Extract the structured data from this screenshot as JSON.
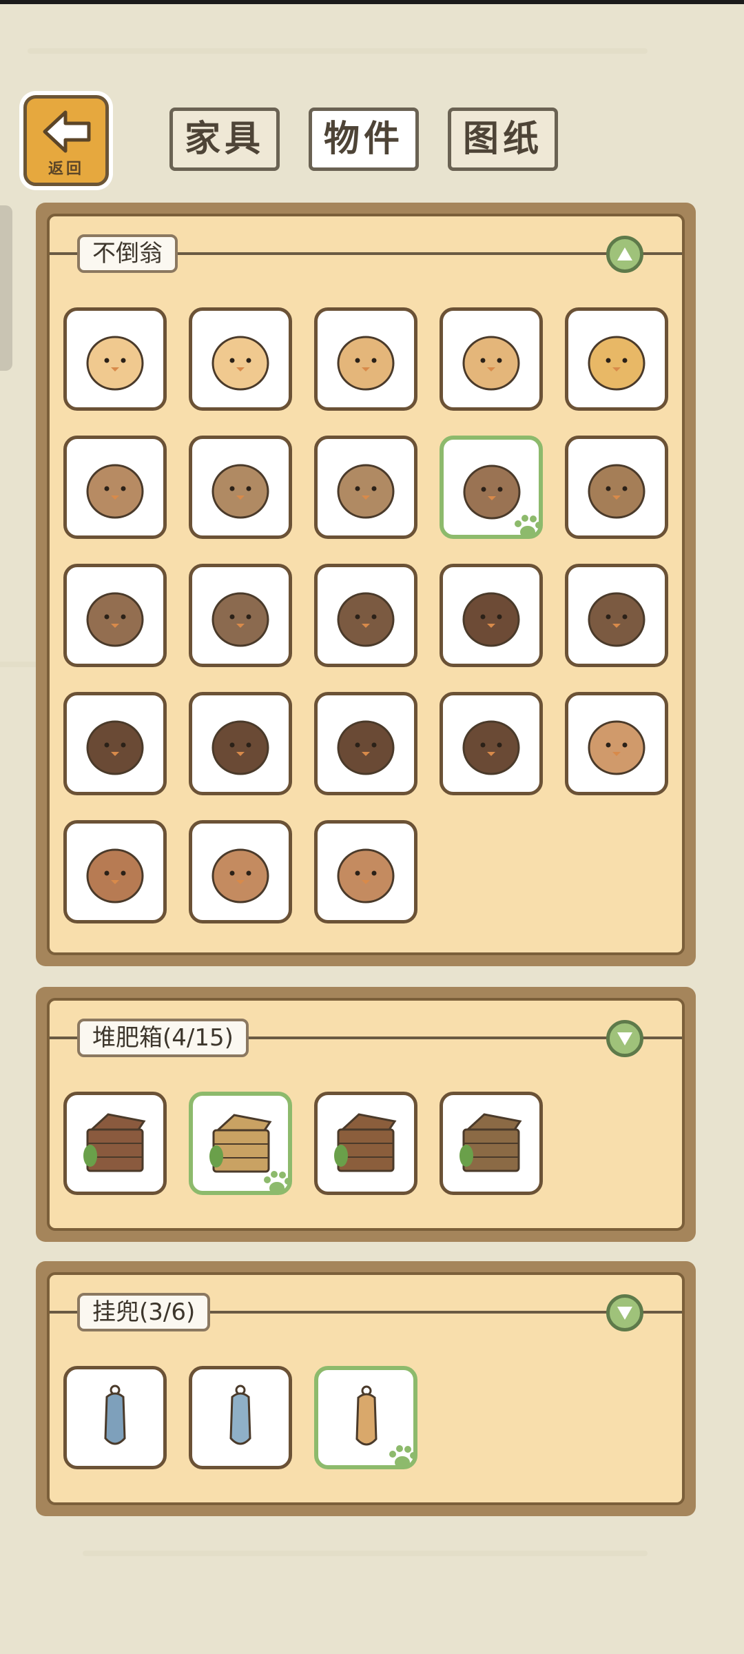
{
  "nav": {
    "back_label": "返回"
  },
  "tabs": [
    {
      "label": "家具",
      "active": false
    },
    {
      "label": "物件",
      "active": true
    },
    {
      "label": "图纸",
      "active": false
    }
  ],
  "sections": [
    {
      "title": "不倒翁",
      "toggle": "collapse-up-icon",
      "items": [
        {
          "icon": "tumbler-antenna-icon",
          "color": "#f0c98f",
          "selected": false
        },
        {
          "icon": "tumbler-cherry-icon",
          "color": "#f0c98f",
          "selected": false
        },
        {
          "icon": "tumbler-spotted-icon",
          "color": "#e4b67a",
          "selected": false
        },
        {
          "icon": "tumbler-heart-icon",
          "color": "#e4b67a",
          "selected": false
        },
        {
          "icon": "tumbler-leaf-icon",
          "color": "#e8b866",
          "selected": false
        },
        {
          "icon": "tumbler-green-cap-icon",
          "color": "#b78b63",
          "selected": false
        },
        {
          "icon": "tumbler-glasses-icon",
          "color": "#b08a63",
          "selected": false
        },
        {
          "icon": "tumbler-hatching-icon",
          "color": "#b08a63",
          "selected": false
        },
        {
          "icon": "tumbler-owl-icon",
          "color": "#9a7353",
          "selected": true
        },
        {
          "icon": "tumbler-sparrow-icon",
          "color": "#a57e57",
          "selected": false
        },
        {
          "icon": "tumbler-sprout-icon",
          "color": "#936e50",
          "selected": false
        },
        {
          "icon": "tumbler-shell-icon",
          "color": "#8b6a4f",
          "selected": false
        },
        {
          "icon": "tumbler-glasses-dark-icon",
          "color": "#7b5a41",
          "selected": false
        },
        {
          "icon": "tumbler-plain-icon",
          "color": "#6d4b36",
          "selected": false
        },
        {
          "icon": "tumbler-leaf-dark-icon",
          "color": "#7b5a41",
          "selected": false
        },
        {
          "icon": "tumbler-round-eyes-icon",
          "color": "#6a4a35",
          "selected": false
        },
        {
          "icon": "tumbler-hatch-dark-icon",
          "color": "#6a4a35",
          "selected": false
        },
        {
          "icon": "tumbler-beak-icon",
          "color": "#6a4a35",
          "selected": false
        },
        {
          "icon": "tumbler-acorn-icon",
          "color": "#6a4a35",
          "selected": false
        },
        {
          "icon": "tumbler-sleepy-icon",
          "color": "#d09a6b",
          "selected": false
        },
        {
          "icon": "tumbler-leaf-hat-icon",
          "color": "#b77b53",
          "selected": false
        },
        {
          "icon": "tumbler-duck-icon",
          "color": "#c48b60",
          "selected": false
        },
        {
          "icon": "tumbler-sprout-arms-icon",
          "color": "#c48b60",
          "selected": false
        }
      ]
    },
    {
      "title": "堆肥箱(4/15)",
      "toggle": "expand-down-icon",
      "items": [
        {
          "icon": "compost-box-red-icon",
          "color": "#8a5a3e",
          "selected": false
        },
        {
          "icon": "compost-box-yellow-icon",
          "color": "#c9a263",
          "selected": true
        },
        {
          "icon": "compost-barrel-icon",
          "color": "#8b5e3c",
          "selected": false
        },
        {
          "icon": "compost-crate-icon",
          "color": "#8b6a45",
          "selected": false
        }
      ]
    },
    {
      "title": "挂兜(3/6)",
      "toggle": "expand-down-icon",
      "items": [
        {
          "icon": "hanging-bag-blue-icon",
          "color": "#7ea0bb",
          "selected": false
        },
        {
          "icon": "hanging-net-blue-icon",
          "color": "#8fb0c7",
          "selected": false
        },
        {
          "icon": "hanging-net-orange-icon",
          "color": "#d9a86b",
          "selected": true
        }
      ]
    }
  ]
}
